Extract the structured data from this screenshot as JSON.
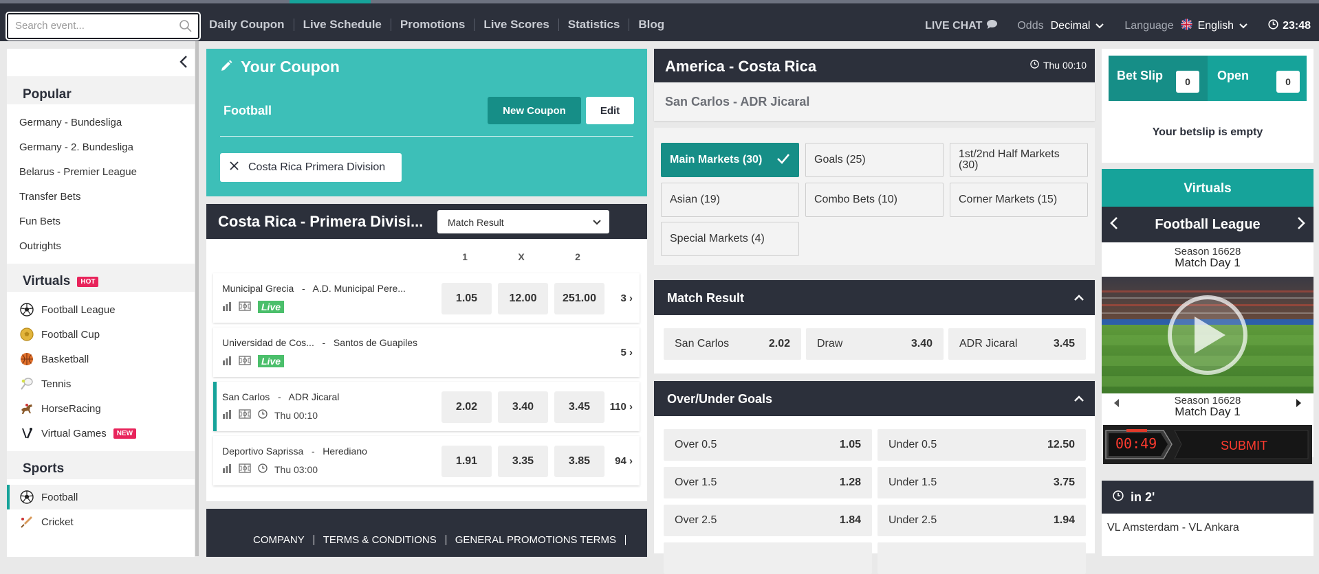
{
  "header": {
    "search_placeholder": "Search event...",
    "nav": [
      "Daily Coupon",
      "Live Schedule",
      "Promotions",
      "Live Scores",
      "Statistics",
      "Blog"
    ],
    "live_chat": "LIVE CHAT",
    "odds_label": "Odds",
    "odds_value": "Decimal",
    "language_label": "Language",
    "language_value": "English",
    "clock": "23:48"
  },
  "sidebar": {
    "popular_title": "Popular",
    "popular": [
      "Germany - Bundesliga",
      "Germany - 2. Bundesliga",
      "Belarus - Premier League",
      "Transfer Bets",
      "Fun Bets",
      "Outrights"
    ],
    "virtuals_title": "Virtuals",
    "virtuals_badge": "HOT",
    "virtuals": [
      "Football League",
      "Football Cup",
      "Basketball",
      "Tennis",
      "HorseRacing",
      "Virtual Games"
    ],
    "virtual_games_badge": "NEW",
    "sports_title": "Sports",
    "sports": [
      "Football",
      "Cricket"
    ]
  },
  "coupon": {
    "title": "Your Coupon",
    "sport": "Football",
    "new_coupon": "New Coupon",
    "edit": "Edit",
    "filter": "Costa Rica Primera Division"
  },
  "matches": {
    "league": "Costa Rica - Primera Divisi...",
    "market_select": "Match Result",
    "cols": [
      "1",
      "X",
      "2"
    ],
    "live_label": "Live",
    "rows": [
      {
        "home": "Municipal Grecia",
        "away": "A.D. Municipal Pere...",
        "time": "",
        "live": true,
        "o1": "1.05",
        "ox": "12.00",
        "o2": "251.00",
        "more": "3"
      },
      {
        "home": "Universidad de Cos...",
        "away": "Santos de Guapiles",
        "time": "",
        "live": true,
        "o1": "",
        "ox": "",
        "o2": "",
        "more": "5"
      },
      {
        "home": "San Carlos",
        "away": "ADR Jicaral",
        "time": "Thu 00:10",
        "live": false,
        "o1": "2.02",
        "ox": "3.40",
        "o2": "3.45",
        "more": "110"
      },
      {
        "home": "Deportivo Saprissa",
        "away": "Herediano",
        "time": "Thu 03:00",
        "live": false,
        "o1": "1.91",
        "ox": "3.35",
        "o2": "3.85",
        "more": "94"
      }
    ],
    "sep": "-"
  },
  "footer": {
    "links": [
      "COMPANY",
      "TERMS & CONDITIONS",
      "GENERAL PROMOTIONS TERMS"
    ]
  },
  "event": {
    "region": "America - Costa Rica",
    "time": "Thu 00:10",
    "name": "San Carlos - ADR Jicaral",
    "markets": [
      "Main Markets (30)",
      "Goals (25)",
      "1st/2nd Half Markets (30)",
      "Asian (19)",
      "Combo Bets (10)",
      "Corner Markets (15)",
      "Special Markets (4)"
    ],
    "match_result_title": "Match Result",
    "match_result": [
      {
        "label": "San Carlos",
        "odd": "2.02"
      },
      {
        "label": "Draw",
        "odd": "3.40"
      },
      {
        "label": "ADR Jicaral",
        "odd": "3.45"
      }
    ],
    "ou_title": "Over/Under Goals",
    "ou": [
      {
        "over": "Over 0.5",
        "over_odd": "1.05",
        "under": "Under 0.5",
        "under_odd": "12.50"
      },
      {
        "over": "Over 1.5",
        "over_odd": "1.28",
        "under": "Under 1.5",
        "under_odd": "3.75"
      },
      {
        "over": "Over 2.5",
        "over_odd": "1.84",
        "under": "Under 2.5",
        "under_odd": "1.94"
      }
    ]
  },
  "betslip": {
    "tab_slip": "Bet Slip",
    "slip_count": "0",
    "tab_open": "Open",
    "open_count": "0",
    "empty": "Your betslip is empty"
  },
  "virtuals_panel": {
    "title": "Virtuals",
    "league": "Football League",
    "season": "Season 16628",
    "match_day": "Match Day 1",
    "timer": "00:49",
    "submit": "SUBMIT"
  },
  "upcoming": {
    "in": "in 2'",
    "match": "VL Amsterdam - VL Ankara"
  },
  "colors": {
    "accent": "#16a39a",
    "dark": "#2c303b",
    "coupon": "#3dbfb8",
    "live": "#4bbf6b",
    "hot": "#e8245b"
  }
}
